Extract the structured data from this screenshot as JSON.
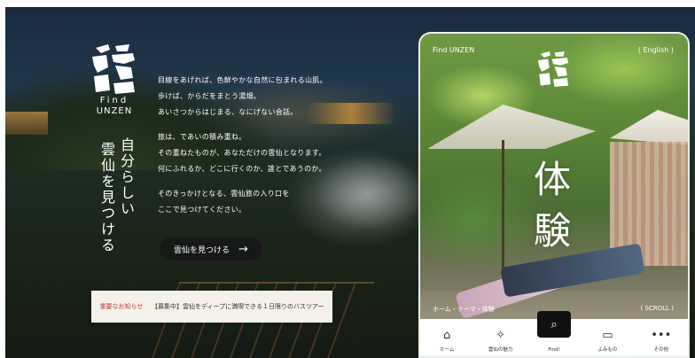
{
  "brand": {
    "logo_text_line1": "Find",
    "logo_text_line2": "UNZEN",
    "logo_icon": "unzen-logo-icon"
  },
  "catch": {
    "col1": "自分らしい",
    "col2": "雲仙を見つける"
  },
  "intro": {
    "para1": [
      "目線をあげれば、色鮮やかな自然に包まれる山肌。",
      "歩けば、からだをまとう湯畑。",
      "あいさつからはじまる、なにげない会話。"
    ],
    "para2": [
      "旅は、であいの積み重ね。",
      "その重ねたものが、あなただけの雲仙となります。",
      "何にふれるか、どこに行くのか、誰とであうのか。"
    ],
    "para3": [
      "そのきっかけとなる、雲仙旅の入り口を",
      "ここで見つけてください。"
    ]
  },
  "cta": {
    "label": "雲仙を見つける",
    "arrow": "→"
  },
  "notice": {
    "tag": "重要なお知らせ",
    "message": "【募集中】雲仙をディープに満喫できる１日限りのバスツアー"
  },
  "phone": {
    "header_left": "Find UNZEN",
    "header_right": "( English )",
    "big_char_1": "体",
    "big_char_2": "験",
    "breadcrumb": "ホーム・テーマ・体験",
    "scroll": "( SCROLL )",
    "tabs": [
      {
        "icon": "home-icon",
        "glyph": "⌂",
        "label": "ホーム"
      },
      {
        "icon": "sparkle-icon",
        "glyph": "✧",
        "label": "雲仙の魅力"
      },
      {
        "icon": "search-icon",
        "glyph": "⌕",
        "label": "Find!"
      },
      {
        "icon": "book-icon",
        "glyph": "▭",
        "label": "よみもの"
      },
      {
        "icon": "more-icon",
        "glyph": "•••",
        "label": "その他"
      }
    ]
  },
  "colors": {
    "notice_tag": "#b23a2f",
    "notice_bg": "#f5f1ea",
    "cta_bg": "#141414"
  }
}
